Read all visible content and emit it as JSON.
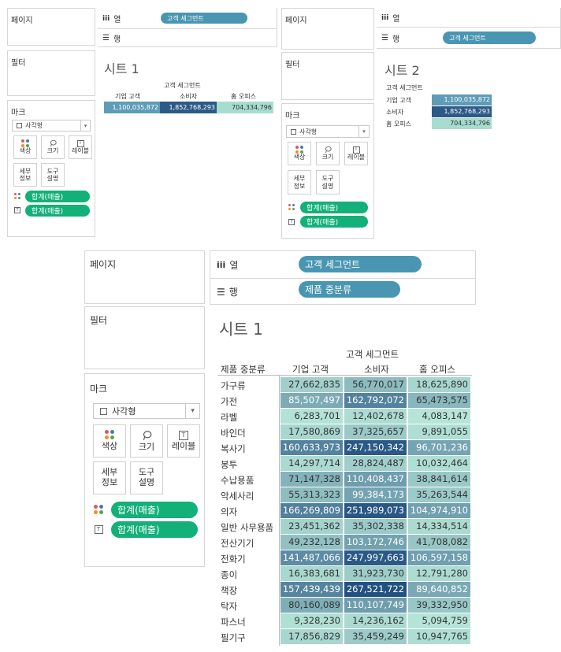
{
  "labels": {
    "pages": "페이지",
    "filters": "필터",
    "marks": "마크",
    "columns": "열",
    "rows": "행",
    "columns_icon": "iii",
    "rows_icon": "☰",
    "mark_type": "사각형",
    "color": "색상",
    "size": "크기",
    "label": "레이블",
    "detail": "세부\n정보",
    "tooltip": "도구\n설명",
    "sum_sales": "합계(매출)",
    "customer_segment": "고객 세그먼트",
    "product_subcategory": "제품 중분류"
  },
  "icons": {
    "color": "color-dots-icon",
    "size": "lasso-icon",
    "label": "text-box-icon",
    "columns": "columns-icon",
    "rows": "rows-icon",
    "checkbox": "mark-checkbox-icon",
    "dropdown": "chevron-down-icon"
  },
  "colors": {
    "pill_blue": "#4996b2",
    "pill_green": "#13b07a",
    "dot_a": "#e15759",
    "dot_b": "#f28e2b",
    "dot_c": "#4e79a7",
    "dot_d": "#59a14f"
  },
  "sheet1_small": {
    "title": "시트 1",
    "column_header": "고객 세그먼트",
    "segments": [
      "기업 고객",
      "소비자",
      "홈 오피스"
    ],
    "values": [
      "1,100,035,872",
      "1,852,768,293",
      "704,334,796"
    ]
  },
  "sheet2": {
    "title": "시트 2",
    "row_header": "고객 세그먼트",
    "segments": [
      "기업 고객",
      "소비자",
      "홈 오피스"
    ],
    "values": [
      "1,100,035,872",
      "1,852,768,293",
      "704,334,796"
    ]
  },
  "sheet1_large": {
    "title": "시트 1",
    "column_header": "고객 세그먼트",
    "row_header": "제품 중분류",
    "segments": [
      "기업 고객",
      "소비자",
      "홈 오피스"
    ],
    "rows": [
      {
        "name": "가구류",
        "values": [
          "27,662,835",
          "56,770,017",
          "18,625,890"
        ]
      },
      {
        "name": "가전",
        "values": [
          "85,507,497",
          "162,792,072",
          "65,473,575"
        ]
      },
      {
        "name": "라벨",
        "values": [
          "6,283,701",
          "12,402,678",
          "4,083,147"
        ]
      },
      {
        "name": "바인더",
        "values": [
          "17,580,869",
          "37,325,657",
          "9,891,055"
        ]
      },
      {
        "name": "복사기",
        "values": [
          "160,633,973",
          "247,150,342",
          "96,701,236"
        ]
      },
      {
        "name": "봉투",
        "values": [
          "14,297,714",
          "28,824,487",
          "10,032,464"
        ]
      },
      {
        "name": "수납용품",
        "values": [
          "71,147,328",
          "110,408,437",
          "38,841,614"
        ]
      },
      {
        "name": "악세사리",
        "values": [
          "55,313,323",
          "99,384,173",
          "35,263,544"
        ]
      },
      {
        "name": "의자",
        "values": [
          "166,269,809",
          "251,989,073",
          "104,974,910"
        ]
      },
      {
        "name": "일반 사무용품",
        "values": [
          "23,451,362",
          "35,302,338",
          "14,334,514"
        ]
      },
      {
        "name": "전산기기",
        "values": [
          "49,232,128",
          "103,172,746",
          "41,708,082"
        ]
      },
      {
        "name": "전화기",
        "values": [
          "141,487,066",
          "247,997,663",
          "106,597,158"
        ]
      },
      {
        "name": "종이",
        "values": [
          "16,383,681",
          "31,923,730",
          "12,791,280"
        ]
      },
      {
        "name": "책장",
        "values": [
          "157,439,439",
          "267,521,722",
          "89,640,852"
        ]
      },
      {
        "name": "탁자",
        "values": [
          "80,160,089",
          "110,107,749",
          "39,332,950"
        ]
      },
      {
        "name": "파스너",
        "values": [
          "9,328,230",
          "14,236,162",
          "5,094,759"
        ]
      },
      {
        "name": "필기구",
        "values": [
          "17,856,829",
          "35,459,249",
          "10,947,765"
        ]
      }
    ]
  }
}
